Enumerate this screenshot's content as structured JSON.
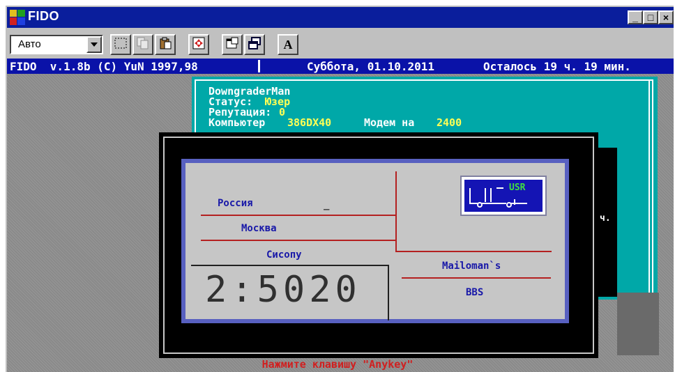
{
  "window": {
    "title": "FIDO",
    "minimize_label": "_",
    "maximize_label": "□",
    "close_label": "×"
  },
  "toolbar": {
    "font_select_value": "Авто",
    "bold_label": "A",
    "icons": [
      "select-icon",
      "copy-icon",
      "paste-icon",
      "zoom-icon",
      "properties-icon",
      "background-icon",
      "font-icon"
    ]
  },
  "status_bar": {
    "program": "FIDO  v.1.8b (C) YuN 1997,98",
    "date": "Суббота, 01.10.2011",
    "time_left": "Осталось 19 ч. 19 мин."
  },
  "user_panel": {
    "name": "DowngraderMan",
    "status_label": "Статус:",
    "status_value": "Юзер",
    "reputation_label": "Репутация:",
    "reputation_value": "0",
    "computer_label": "Компьютер",
    "computer_value": "386DX40",
    "modem_label": "Модем на",
    "modem_value": "2400",
    "side_text": "ч."
  },
  "card": {
    "country": "Россия",
    "city": "Москва",
    "role": "Сисопу",
    "fido_address": "2:5020",
    "station": "Mailoman`s",
    "type": "BBS",
    "logo_text": "USR",
    "country_mark": "_"
  },
  "hint": "Нажмите клавишу \"Anykey\""
}
